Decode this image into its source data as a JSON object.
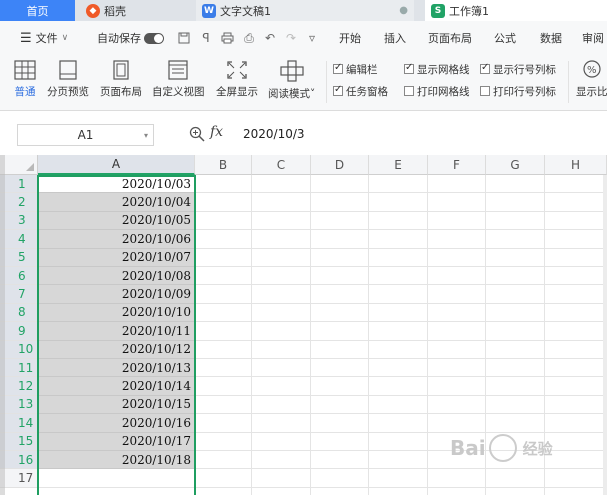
{
  "tabs": {
    "home": "首页",
    "shell": "稻壳",
    "doc": "文字文稿1",
    "workbook": "工作簿1"
  },
  "menu": {
    "file": "文件",
    "autosave": "自动保存",
    "start": "开始",
    "insert": "插入",
    "page_layout": "页面布局",
    "formula": "公式",
    "data": "数据",
    "review": "审阅"
  },
  "ribbon": {
    "normal": "普通",
    "page_break_preview": "分页预览",
    "page_layout_view": "页面布局",
    "custom_view": "自定义视图",
    "full_screen": "全屏显示",
    "reading_mode": "阅读模式",
    "display_ratio": "显示比",
    "checkboxes": {
      "edit_bar": "编辑栏",
      "show_gridlines": "显示网格线",
      "show_row_col_headers": "显示行号列标",
      "task_pane": "任务窗格",
      "print_gridlines": "打印网格线",
      "print_row_col_headers": "打印行号列标"
    }
  },
  "formula_bar": {
    "cell_ref": "A1",
    "fx": "fx",
    "content": "2020/10/3"
  },
  "columns": [
    "A",
    "B",
    "C",
    "D",
    "E",
    "F",
    "G",
    "H"
  ],
  "rows": [
    "1",
    "2",
    "3",
    "4",
    "5",
    "6",
    "7",
    "8",
    "9",
    "10",
    "11",
    "12",
    "13",
    "14",
    "15",
    "16",
    "17"
  ],
  "cells_A": [
    "2020/10/03",
    "2020/10/04",
    "2020/10/05",
    "2020/10/06",
    "2020/10/07",
    "2020/10/08",
    "2020/10/09",
    "2020/10/10",
    "2020/10/11",
    "2020/10/12",
    "2020/10/13",
    "2020/10/14",
    "2020/10/15",
    "2020/10/16",
    "2020/10/17",
    "2020/10/18"
  ],
  "watermark": {
    "brand_left": "Bai",
    "brand_right": "经验"
  },
  "colors": {
    "accent_blue": "#3d84f7",
    "selection_green": "#1f9e61",
    "selected_fill": "#d7d7d7"
  }
}
